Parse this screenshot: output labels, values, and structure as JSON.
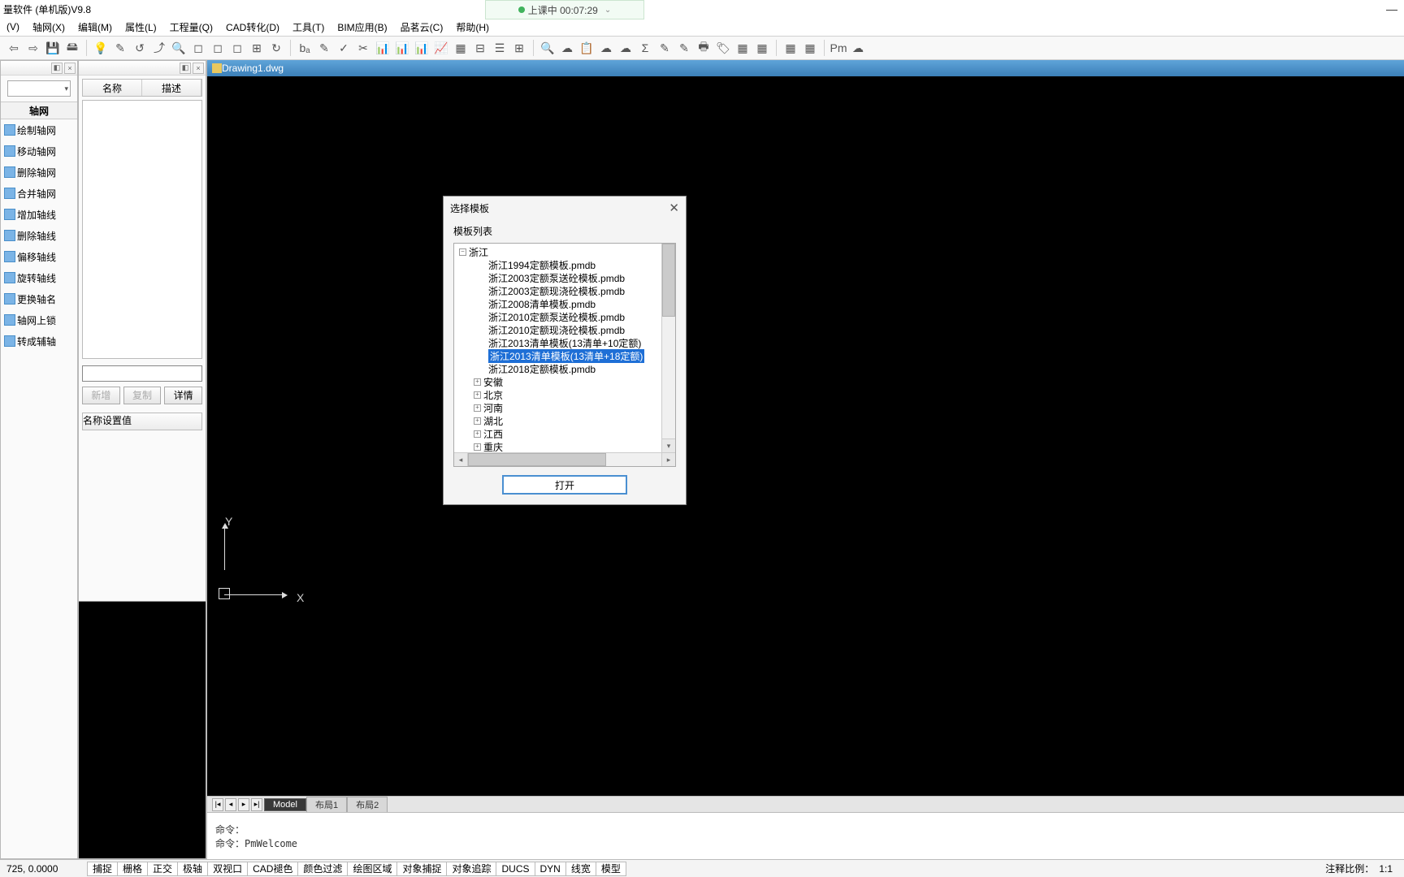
{
  "app": {
    "title": "量软件 (单机版)V9.8"
  },
  "timer": {
    "label": "上课中 00:07:29"
  },
  "menu": [
    "(V)",
    "轴网(X)",
    "编辑(M)",
    "属性(L)",
    "工程量(Q)",
    "CAD转化(D)",
    "工具(T)",
    "BIM应用(B)",
    "品茗云(C)",
    "帮助(H)"
  ],
  "sidebar": {
    "section": "轴网",
    "tools": [
      "绘制轴网",
      "移动轴网",
      "删除轴网",
      "合并轴网",
      "增加轴线",
      "删除轴线",
      "偏移轴线",
      "旋转轴线",
      "更换轴名",
      "轴网上锁",
      "转成辅轴"
    ]
  },
  "panel2": {
    "cols": [
      "名称",
      "描述"
    ],
    "btns": [
      "新增",
      "复制",
      "详情"
    ],
    "cols2": [
      "名称",
      "设置值"
    ]
  },
  "drawing": {
    "filename": "Drawing1.dwg",
    "ylabel": "Y",
    "xlabel": "X"
  },
  "tabs": {
    "model": "Model",
    "layouts": [
      "布局1",
      "布局2"
    ]
  },
  "cmd": {
    "l1": "命令：",
    "l2": "命令：PmWelcome"
  },
  "status": {
    "coords": "725, 0.0000",
    "modes": [
      "捕捉",
      "栅格",
      "正交",
      "极轴",
      "双视口",
      "CAD褪色",
      "颜色过滤",
      "绘图区域",
      "对象捕捉",
      "对象追踪",
      "DUCS",
      "DYN",
      "线宽",
      "模型"
    ],
    "right_label": "注释比例：",
    "right_val": "1:1"
  },
  "dialog": {
    "title": "选择模板",
    "list_label": "模板列表",
    "root": "浙江",
    "files": [
      "浙江1994定额模板.pmdb",
      "浙江2003定额泵送砼模板.pmdb",
      "浙江2003定额现浇砼模板.pmdb",
      "浙江2008清单模板.pmdb",
      "浙江2010定额泵送砼模板.pmdb",
      "浙江2010定额现浇砼模板.pmdb",
      "浙江2013清单模板(13清单+10定额)",
      "浙江2013清单模板(13清单+18定额)",
      "浙江2018定额模板.pmdb"
    ],
    "selected_index": 7,
    "provinces": [
      "安徽",
      "北京",
      "河南",
      "湖北",
      "江西",
      "重庆"
    ],
    "open": "打开"
  }
}
